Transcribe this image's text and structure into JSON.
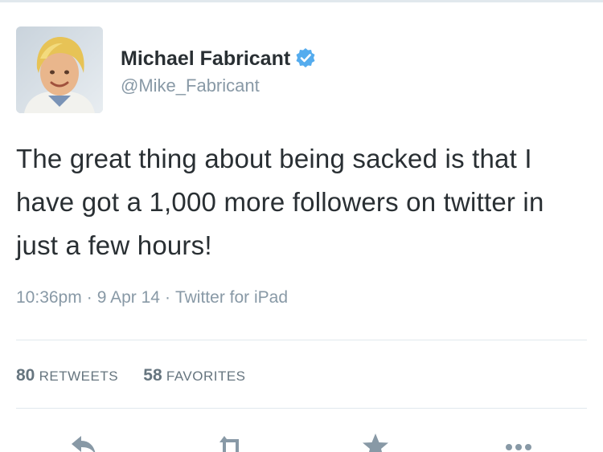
{
  "tweet": {
    "author": {
      "name": "Michael Fabricant",
      "handle": "@Mike_Fabricant",
      "verified_icon": "verified-badge-icon",
      "avatar": "profile-photo"
    },
    "text": "The great thing about being sacked is that I have got a 1,000 more followers on twitter in just a few hours!",
    "meta": {
      "time": "10:36pm",
      "separator": "·",
      "date": "9 Apr 14",
      "source": "Twitter for iPad"
    },
    "stats": [
      {
        "count": "80",
        "label": "Retweets"
      },
      {
        "count": "58",
        "label": "Favorites"
      }
    ],
    "actions": [
      {
        "name": "reply-icon"
      },
      {
        "name": "retweet-icon"
      },
      {
        "name": "favorite-star-icon"
      },
      {
        "name": "more-dots-icon"
      }
    ]
  },
  "colors": {
    "verified": "#55acee",
    "text": "#292f33",
    "muted": "#8899a6",
    "divider": "#e1e8ed"
  }
}
